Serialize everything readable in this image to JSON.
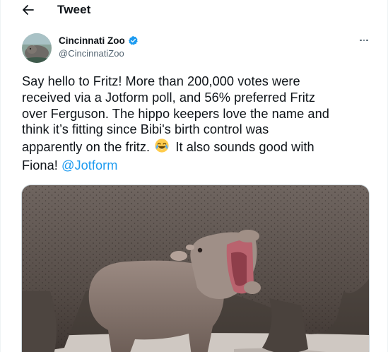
{
  "header": {
    "title": "Tweet",
    "back_icon": "arrow-left-icon"
  },
  "author": {
    "display_name": "Cincinnati Zoo",
    "handle": "@CincinnatiZoo",
    "verified_icon": "verified-badge-icon",
    "avatar_icon": "avatar-photo"
  },
  "more_icon": "more-options-icon",
  "tweet": {
    "line1": "Say hello to Fritz! More than 200,000 votes were",
    "line2": "received via a Jotform poll, and 56% preferred Fritz",
    "line3": "over Ferguson. The hippo keepers love the name and",
    "line4": "think it’s fitting since Bibi's birth control was",
    "line5_before_emoji": "apparently on the fritz.",
    "emoji": "face-with-tears-of-joy-emoji",
    "line5_after_emoji": "It also sounds good with",
    "line6": "Fiona!",
    "mention": "@Jotform"
  },
  "media": {
    "subject": "hippo-photo"
  },
  "colors": {
    "accent": "#1d9bf0",
    "text_primary": "#0f1419",
    "text_secondary": "#536471",
    "border": "#cfd9de"
  }
}
